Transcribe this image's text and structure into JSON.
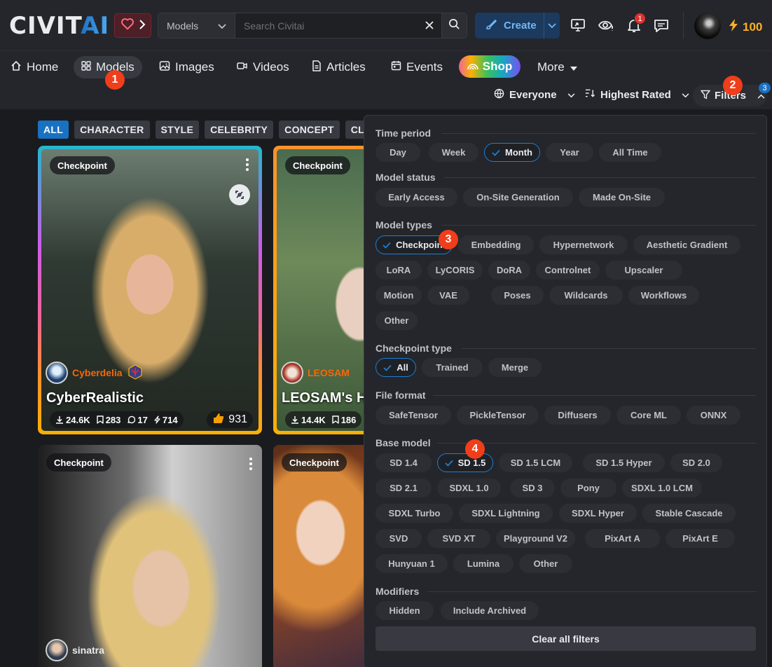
{
  "header": {
    "logo_text_a": "CIVIT",
    "logo_text_b": "AI",
    "search_type": "Models",
    "search_placeholder": "Search Civitai",
    "create_label": "Create",
    "notifications_count": "1",
    "buzz_amount": "100"
  },
  "nav": {
    "items": [
      {
        "label": "Home",
        "icon": "home-icon"
      },
      {
        "label": "Models",
        "icon": "grid-icon"
      },
      {
        "label": "Images",
        "icon": "photo-icon"
      },
      {
        "label": "Videos",
        "icon": "video-icon"
      },
      {
        "label": "Articles",
        "icon": "file-text-icon"
      },
      {
        "label": "Events",
        "icon": "calendar-icon"
      }
    ],
    "shop_label": "Shop",
    "more_label": "More",
    "browsing_level": "Everyone",
    "sort": "Highest Rated",
    "filters_label": "Filters",
    "filters_count": "3"
  },
  "markers": [
    "1",
    "2",
    "3",
    "4"
  ],
  "categories": [
    "ALL",
    "CHARACTER",
    "STYLE",
    "CELEBRITY",
    "CONCEPT",
    "CLO"
  ],
  "cards": [
    {
      "type": "Checkpoint",
      "creator": "Cyberdelia",
      "title": "CyberRealistic",
      "downloads": "24.6K",
      "collected": "283",
      "comments": "17",
      "tips": "714",
      "likes": "931"
    },
    {
      "type": "Checkpoint",
      "creator": "LEOSAM",
      "title": "LEOSAM's H",
      "downloads": "14.4K",
      "collected": "186"
    },
    {
      "type": "Checkpoint",
      "creator": "sinatra"
    },
    {
      "type": "Checkpoint"
    }
  ],
  "filters": {
    "time_period": {
      "title": "Time period",
      "options": [
        "Day",
        "Week",
        "Month",
        "Year",
        "All Time"
      ],
      "selected": "Month"
    },
    "model_status": {
      "title": "Model status",
      "options": [
        "Early Access",
        "On-Site Generation",
        "Made On-Site"
      ]
    },
    "model_types": {
      "title": "Model types",
      "options": [
        "Checkpoint",
        "Embedding",
        "Hypernetwork",
        "Aesthetic Gradient",
        "LoRA",
        "LyCORIS",
        "DoRA",
        "Controlnet",
        "Upscaler",
        "Motion",
        "VAE",
        "Poses",
        "Wildcards",
        "Workflows",
        "Other"
      ],
      "selected": "Checkpoint"
    },
    "checkpoint_type": {
      "title": "Checkpoint type",
      "options": [
        "All",
        "Trained",
        "Merge"
      ],
      "selected": "All"
    },
    "file_format": {
      "title": "File format",
      "options": [
        "SafeTensor",
        "PickleTensor",
        "Diffusers",
        "Core ML",
        "ONNX"
      ]
    },
    "base_model": {
      "title": "Base model",
      "options": [
        "SD 1.4",
        "SD 1.5",
        "SD 1.5 LCM",
        "SD 1.5 Hyper",
        "SD 2.0",
        "SD 2.1",
        "SDXL 1.0",
        "SD 3",
        "Pony",
        "SDXL 1.0 LCM",
        "SDXL Turbo",
        "SDXL Lightning",
        "SDXL Hyper",
        "Stable Cascade",
        "SVD",
        "SVD XT",
        "Playground V2",
        "PixArt A",
        "PixArt E",
        "Hunyuan 1",
        "Lumina",
        "Other"
      ],
      "selected": "SD 1.5"
    },
    "modifiers": {
      "title": "Modifiers",
      "options": [
        "Hidden",
        "Include Archived"
      ]
    },
    "clear_label": "Clear all filters"
  },
  "colors": {
    "accent": "#1971c2",
    "buzz": "#fcb026",
    "marker": "#f03e1a",
    "creator_name": "#f76707"
  }
}
